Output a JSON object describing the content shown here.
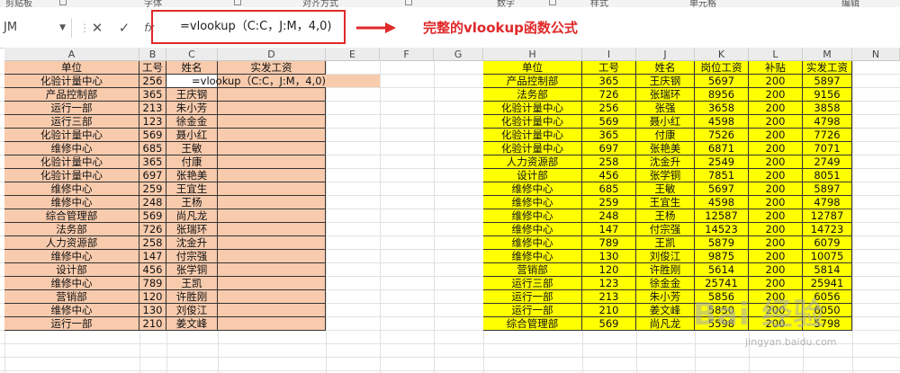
{
  "ribbon": {
    "groups": [
      "剪贴板",
      "字体",
      "对齐方式",
      "数字",
      "样式",
      "单元格",
      "编辑"
    ]
  },
  "formula_bar": {
    "name_box": "JM",
    "cancel": "✕",
    "confirm": "✓",
    "fx": "fx",
    "formula": "=vlookup（C:C，J:M，4,0)",
    "annotation": "完整的vlookup函数公式"
  },
  "columns": [
    "A",
    "B",
    "C",
    "D",
    "E",
    "F",
    "G",
    "H",
    "I",
    "J",
    "K",
    "L",
    "M",
    "N"
  ],
  "left_table": {
    "headers": [
      "单位",
      "工号",
      "姓名",
      "实发工资"
    ],
    "formula_cell": "=vlookup（C:C，J:M，4,0)",
    "rows": [
      [
        "化验计量中心",
        "256",
        "",
        ""
      ],
      [
        "产品控制部",
        "365",
        "王庆钢",
        ""
      ],
      [
        "运行一部",
        "213",
        "朱小芳",
        ""
      ],
      [
        "运行三部",
        "123",
        "徐金金",
        ""
      ],
      [
        "化验计量中心",
        "569",
        "聂小红",
        ""
      ],
      [
        "维修中心",
        "685",
        "王敏",
        ""
      ],
      [
        "化验计量中心",
        "365",
        "付康",
        ""
      ],
      [
        "化验计量中心",
        "697",
        "张艳美",
        ""
      ],
      [
        "维修中心",
        "259",
        "王宜生",
        ""
      ],
      [
        "维修中心",
        "248",
        "王杨",
        ""
      ],
      [
        "综合管理部",
        "569",
        "尚凡龙",
        ""
      ],
      [
        "法务部",
        "726",
        "张瑞环",
        ""
      ],
      [
        "人力资源部",
        "258",
        "沈金升",
        ""
      ],
      [
        "维修中心",
        "147",
        "付宗强",
        ""
      ],
      [
        "设计部",
        "456",
        "张学铜",
        ""
      ],
      [
        "维修中心",
        "789",
        "王凯",
        ""
      ],
      [
        "营销部",
        "120",
        "许胜刚",
        ""
      ],
      [
        "维修中心",
        "130",
        "刘俊江",
        ""
      ],
      [
        "运行一部",
        "210",
        "姜文峰",
        ""
      ]
    ]
  },
  "right_table": {
    "headers": [
      "单位",
      "工号",
      "姓名",
      "岗位工资",
      "补贴",
      "实发工资"
    ],
    "rows": [
      [
        "产品控制部",
        "365",
        "王庆钢",
        "5697",
        "200",
        "5897"
      ],
      [
        "法务部",
        "726",
        "张瑞环",
        "8956",
        "200",
        "9156"
      ],
      [
        "化验计量中心",
        "256",
        "张强",
        "3658",
        "200",
        "3858"
      ],
      [
        "化验计量中心",
        "569",
        "聂小红",
        "4598",
        "200",
        "4798"
      ],
      [
        "化验计量中心",
        "365",
        "付康",
        "7526",
        "200",
        "7726"
      ],
      [
        "化验计量中心",
        "697",
        "张艳美",
        "6871",
        "200",
        "7071"
      ],
      [
        "人力资源部",
        "258",
        "沈金升",
        "2549",
        "200",
        "2749"
      ],
      [
        "设计部",
        "456",
        "张学铜",
        "7851",
        "200",
        "8051"
      ],
      [
        "维修中心",
        "685",
        "王敏",
        "5697",
        "200",
        "5897"
      ],
      [
        "维修中心",
        "259",
        "王宜生",
        "4598",
        "200",
        "4798"
      ],
      [
        "维修中心",
        "248",
        "王杨",
        "12587",
        "200",
        "12787"
      ],
      [
        "维修中心",
        "147",
        "付宗强",
        "14523",
        "200",
        "14723"
      ],
      [
        "维修中心",
        "789",
        "王凯",
        "5879",
        "200",
        "6079"
      ],
      [
        "维修中心",
        "130",
        "刘俊江",
        "9875",
        "200",
        "10075"
      ],
      [
        "营销部",
        "120",
        "许胜刚",
        "5614",
        "200",
        "5814"
      ],
      [
        "运行三部",
        "123",
        "徐金金",
        "25741",
        "200",
        "25941"
      ],
      [
        "运行一部",
        "213",
        "朱小芳",
        "5856",
        "200",
        "6056"
      ],
      [
        "运行一部",
        "210",
        "姜文峰",
        "5850",
        "200",
        "6050"
      ],
      [
        "综合管理部",
        "569",
        "尚凡龙",
        "5598",
        "200",
        "5798"
      ]
    ]
  },
  "watermark": {
    "text": "Bai 经验",
    "sub": "jingyan.baidu.com"
  },
  "colors": {
    "peach": "#f8cbad",
    "yellow": "#ffff00",
    "accent_red": "#e0292a"
  }
}
